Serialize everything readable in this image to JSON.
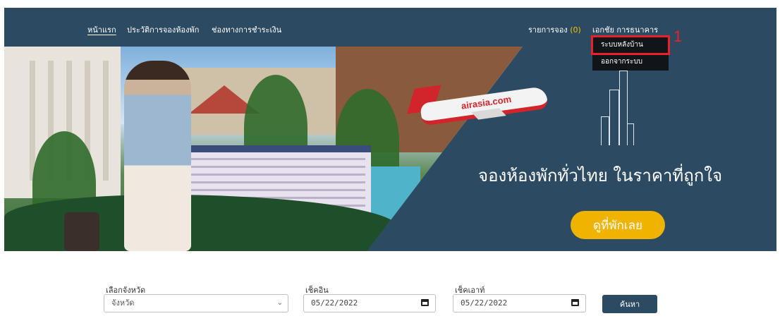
{
  "nav": {
    "home": "หน้าแรก",
    "booking_history": "ประวัติการจองห้องพัก",
    "payment_channels": "ช่องทางการชำระเงิน",
    "bookings_label": "รายการจอง",
    "bookings_count": "(0)",
    "user_name": "เอกชัย การธนาคาร"
  },
  "user_menu": {
    "items": [
      "ระบบหลังบ้าน",
      "ออกจากระบบ"
    ],
    "highlighted_index": 0,
    "highlight_color": "#e8222a"
  },
  "annotation": {
    "step_number": "1"
  },
  "hero": {
    "plane_logo": "airasia.com",
    "tagline": "จองห้องพักทั่วไทย ในราคาที่ถูกใจ",
    "cta_label": "ดูที่พักเลย",
    "background_color": "#2c4a62",
    "cta_color": "#f0b400"
  },
  "search": {
    "province_label": "เลือกจังหวัด",
    "province_value": "จังหวัด",
    "checkin_label": "เช็คอิน",
    "checkin_value": "05/22/2022",
    "checkout_label": "เช็คเอาท์",
    "checkout_value": "05/22/2022",
    "submit_label": "ค้นหา"
  }
}
